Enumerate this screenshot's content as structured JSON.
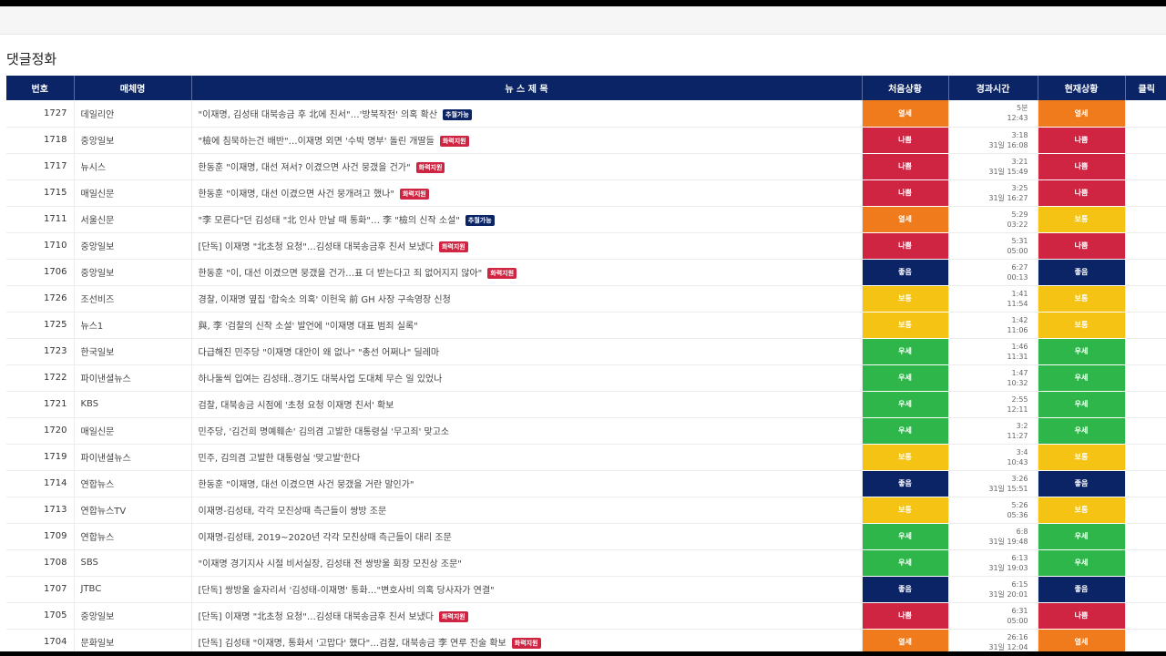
{
  "page_title": "댓글정화",
  "headers": [
    "번호",
    "매체명",
    "뉴 스 제 목",
    "처음상황",
    "경과시간",
    "현재상황",
    "클릭"
  ],
  "status_colors": {
    "열세": "#ef7b1d",
    "나쁨": "#cf2442",
    "보통": "#f5c313",
    "우세": "#2fb64b",
    "좋음": "#0b2466"
  },
  "badge_colors": {
    "추월가능": "#0b2466",
    "화력지원": "#cf2442"
  },
  "rows": [
    {
      "no": "1727",
      "media": "데일리안",
      "title": "\"이재명, 김성태 대북송금 후 北에 친서\"…'방북작전' 의혹 확산",
      "badge": "추월가능",
      "first": "열세",
      "elapsed": "5분",
      "time": "12:43",
      "current": "열세"
    },
    {
      "no": "1718",
      "media": "중앙일보",
      "title": "\"檢에 침묵하는건 배반\"…이재명 외면 '수박 명부' 돌린 개딸들",
      "badge": "화력지원",
      "first": "나쁨",
      "elapsed": "3:18",
      "time": "31일 16:08",
      "current": "나쁨"
    },
    {
      "no": "1717",
      "media": "뉴시스",
      "title": "한동훈 \"이재명, 대선 져서? 이겼으면 사건 뭉갰을 건가\"",
      "badge": "화력지원",
      "first": "나쁨",
      "elapsed": "3:21",
      "time": "31일 15:49",
      "current": "나쁨"
    },
    {
      "no": "1715",
      "media": "매일신문",
      "title": "한동훈 \"이재명, 대선 이겼으면 사건 뭉개려고 했나\"",
      "badge": "화력지원",
      "first": "나쁨",
      "elapsed": "3:25",
      "time": "31일 16:27",
      "current": "나쁨"
    },
    {
      "no": "1711",
      "media": "서울신문",
      "title": "\"李 모른다\"던 김성태 \"北 인사 만날 때 통화\"… 李 \"檢의 신작 소설\"",
      "badge": "추월가능",
      "first": "열세",
      "elapsed": "5:29",
      "time": "03:22",
      "current": "보통"
    },
    {
      "no": "1710",
      "media": "중앙일보",
      "title": "[단독] 이재명 \"北초청 요청\"…김성태 대북송금후 친서 보냈다",
      "badge": "화력지원",
      "first": "나쁨",
      "elapsed": "5:31",
      "time": "05:00",
      "current": "나쁨"
    },
    {
      "no": "1706",
      "media": "중앙일보",
      "title": "한동훈 \"이, 대선 이겼으면 뭉갰을 건가…표 더 받는다고 죄 없어지지 않아\"",
      "badge": "화력지원",
      "first": "좋음",
      "elapsed": "6:27",
      "time": "00:13",
      "current": "좋음"
    },
    {
      "no": "1726",
      "media": "조선비즈",
      "title": "경찰, 이재명 옆집 '합숙소 의혹' 이헌욱 前 GH 사장 구속영장 신청",
      "badge": "",
      "first": "보통",
      "elapsed": "1:41",
      "time": "11:54",
      "current": "보통"
    },
    {
      "no": "1725",
      "media": "뉴스1",
      "title": "與, 李 '검찰의 신작 소설' 발언에 \"이재명 대표 범죄 실록\"",
      "badge": "",
      "first": "보통",
      "elapsed": "1:42",
      "time": "11:06",
      "current": "보통"
    },
    {
      "no": "1723",
      "media": "한국일보",
      "title": "다급해진 민주당 \"이재명 대안이 왜 없나\" \"총선 어쩌나\" 딜레마",
      "badge": "",
      "first": "우세",
      "elapsed": "1:46",
      "time": "11:31",
      "current": "우세"
    },
    {
      "no": "1722",
      "media": "파이낸셜뉴스",
      "title": "하나둘씩 입여는 김성태..경기도 대북사업 도대체 무슨 일 있었나",
      "badge": "",
      "first": "우세",
      "elapsed": "1:47",
      "time": "10:32",
      "current": "우세"
    },
    {
      "no": "1721",
      "media": "KBS",
      "title": "검찰, 대북송금 시점에 '초청 요청 이재명 친서' 확보",
      "badge": "",
      "first": "우세",
      "elapsed": "2:55",
      "time": "12:11",
      "current": "우세"
    },
    {
      "no": "1720",
      "media": "매일신문",
      "title": "민주당, '김건희 명예훼손' 김의겸 고발한 대통령실 '무고죄' 맞고소",
      "badge": "",
      "first": "우세",
      "elapsed": "3:2",
      "time": "11:27",
      "current": "우세"
    },
    {
      "no": "1719",
      "media": "파이낸셜뉴스",
      "title": "민주, 김의겸 고발한 대통령실 '맞고발'한다",
      "badge": "",
      "first": "보통",
      "elapsed": "3:4",
      "time": "10:43",
      "current": "보통"
    },
    {
      "no": "1714",
      "media": "연합뉴스",
      "title": "한동훈 \"이재명, 대선 이겼으면 사건 뭉갰을 거란 말인가\"",
      "badge": "",
      "first": "좋음",
      "elapsed": "3:26",
      "time": "31일 15:51",
      "current": "좋음"
    },
    {
      "no": "1713",
      "media": "연합뉴스TV",
      "title": "이재명-김성태, 각각 모친상때 측근들이 쌍방 조문",
      "badge": "",
      "first": "보통",
      "elapsed": "5:26",
      "time": "05:36",
      "current": "보통"
    },
    {
      "no": "1709",
      "media": "연합뉴스",
      "title": "이재명-김성태, 2019~2020년 각각 모친상때 측근들이 대리 조문",
      "badge": "",
      "first": "우세",
      "elapsed": "6:8",
      "time": "31일 19:48",
      "current": "우세"
    },
    {
      "no": "1708",
      "media": "SBS",
      "title": "\"이재명 경기지사 시절 비서실장, 김성태 전 쌍방울 회장 모친상 조문\"",
      "badge": "",
      "first": "우세",
      "elapsed": "6:13",
      "time": "31일 19:03",
      "current": "우세"
    },
    {
      "no": "1707",
      "media": "JTBC",
      "title": "[단독] 쌍방울 술자리서 '김성태-이재명' 통화…\"변호사비 의혹 당사자가 연결\"",
      "badge": "",
      "first": "좋음",
      "elapsed": "6:15",
      "time": "31일 20:01",
      "current": "좋음"
    },
    {
      "no": "1705",
      "media": "중앙일보",
      "title": "[단독] 이재명 \"北초청 요청\"…김성태 대북송금후 친서 보냈다",
      "badge": "화력지원",
      "first": "나쁨",
      "elapsed": "6:31",
      "time": "05:00",
      "current": "나쁨"
    },
    {
      "no": "1704",
      "media": "문화일보",
      "title": "[단독] 김성태 \"이재명, 통화서 '고맙다' 했다\"…검찰, 대북송금 李 연루 진술 확보",
      "badge": "화력지원",
      "first": "열세",
      "elapsed": "26:16",
      "time": "31일 12:04",
      "current": "열세"
    }
  ]
}
